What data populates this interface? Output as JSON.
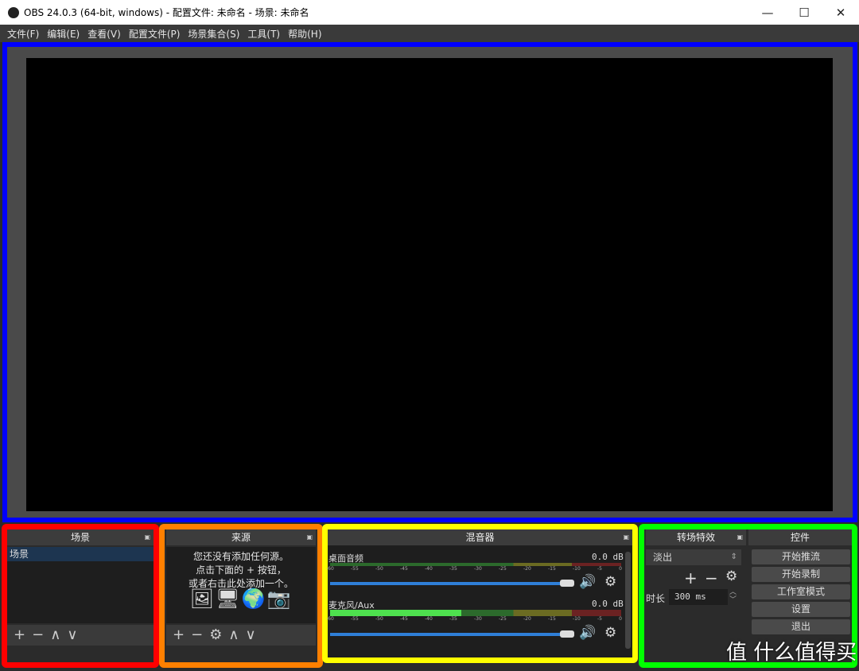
{
  "window": {
    "title": "OBS 24.0.3 (64-bit, windows) - 配置文件: 未命名 - 场景: 未命名",
    "minimize": "—",
    "maximize": "☐",
    "close": "✕"
  },
  "menu": [
    "文件(F)",
    "编辑(E)",
    "查看(V)",
    "配置文件(P)",
    "场景集合(S)",
    "工具(T)",
    "帮助(H)"
  ],
  "annotation_colors": {
    "preview": "#0000ff",
    "scenes": "#ff0000",
    "sources": "#ff8000",
    "mixer": "#ffff00",
    "controls": "#00ff00"
  },
  "scenes": {
    "title": "场景",
    "items": [
      "场景"
    ],
    "toolbar": [
      "+",
      "−",
      "∧",
      "∨"
    ]
  },
  "sources": {
    "title": "来源",
    "empty_lines": [
      "您还没有添加任何源。",
      "点击下面的 + 按钮，",
      "或者右击此处添加一个。"
    ],
    "icons": [
      "image-icon",
      "display-icon",
      "globe-icon",
      "camera-icon"
    ],
    "toolbar": [
      "+",
      "−",
      "⚙",
      "∧",
      "∨"
    ]
  },
  "mixer": {
    "title": "混音器",
    "ticks": [
      "-60",
      "-55",
      "-50",
      "-45",
      "-40",
      "-35",
      "-30",
      "-25",
      "-20",
      "-15",
      "-10",
      "-5",
      "0"
    ],
    "channels": [
      {
        "name": "桌面音频",
        "db": "0.0 dB",
        "level": 0,
        "volume": 1
      },
      {
        "name": "麦克风/Aux",
        "db": "0.0 dB",
        "level": 0.45,
        "volume": 1
      }
    ]
  },
  "transitions": {
    "title": "转场特效",
    "selected": "淡出",
    "duration_label": "时长",
    "duration": "300 ms"
  },
  "controls": {
    "title": "控件",
    "buttons": [
      "开始推流",
      "开始录制",
      "工作室模式",
      "设置",
      "退出"
    ]
  },
  "watermark": "值 什么值得买"
}
